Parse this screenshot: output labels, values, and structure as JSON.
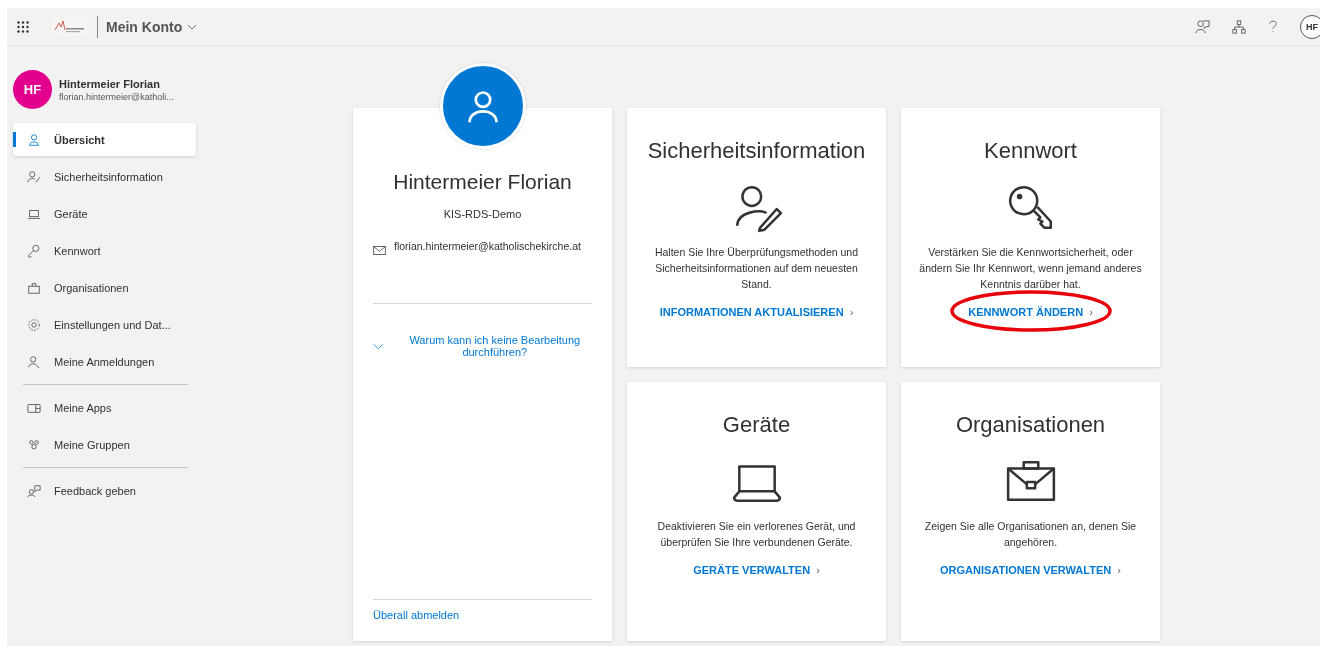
{
  "header": {
    "app_title": "Mein Konto",
    "avatar": "HF"
  },
  "sidebar": {
    "user": {
      "initials": "HF",
      "name": "Hintermeier Florian",
      "email": "florian.hintermeier@katholi..."
    },
    "groups": [
      [
        {
          "label": "Übersicht",
          "selected": true
        },
        {
          "label": "Sicherheitsinformation",
          "selected": false
        },
        {
          "label": "Geräte",
          "selected": false
        },
        {
          "label": "Kennwort",
          "selected": false
        },
        {
          "label": "Organisationen",
          "selected": false
        },
        {
          "label": "Einstellungen und Dat...",
          "selected": false
        },
        {
          "label": "Meine Anmeldungen",
          "selected": false
        }
      ],
      [
        {
          "label": "Meine Apps",
          "selected": false
        },
        {
          "label": "Meine Gruppen",
          "selected": false
        }
      ],
      [
        {
          "label": "Feedback geben",
          "selected": false
        }
      ]
    ]
  },
  "profile": {
    "name": "Hintermeier Florian",
    "organization": "KIS-RDS-Demo",
    "email": "florian.hintermeier@katholischekirche.at",
    "help_link": "Warum kann ich keine Bearbeitung durchführen?",
    "signout_link": "Überall abmelden"
  },
  "cards": [
    {
      "title": "Sicherheitsinformation",
      "description": "Halten Sie Ihre Überprüfungsmethoden und Sicherheitsinformationen auf dem neuesten Stand.",
      "link": "INFORMATIONEN AKTUALISIEREN",
      "chevron": "›",
      "highlighted": false
    },
    {
      "title": "Kennwort",
      "description": "Verstärken Sie die Kennwortsicherheit, oder ändern Sie Ihr Kennwort, wenn jemand anderes Kenntnis darüber hat.",
      "link": "KENNWORT ÄNDERN",
      "chevron": "›",
      "highlighted": true
    },
    {
      "title": "Geräte",
      "description": "Deaktivieren Sie ein verlorenes Gerät, und überprüfen Sie Ihre verbundenen Geräte.",
      "link": "GERÄTE VERWALTEN",
      "chevron": "›",
      "highlighted": false
    },
    {
      "title": "Organisationen",
      "description": "Zeigen Sie alle Organisationen an, denen Sie angehören.",
      "link": "ORGANISATIONEN VERWALTEN",
      "chevron": "›",
      "highlighted": false
    }
  ]
}
